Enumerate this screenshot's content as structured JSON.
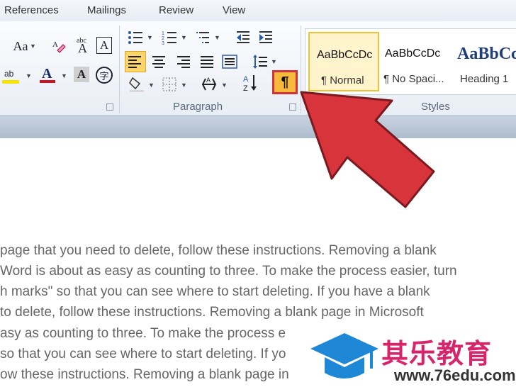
{
  "tabs": [
    "References",
    "Mailings",
    "Review",
    "View"
  ],
  "font_group": {
    "change_case_label": "Aa",
    "phonetic_label": "abc",
    "char_border_label": "A",
    "font_color_label": "A",
    "char_shading_label": "A",
    "enclose_char_label": "字",
    "font_color_hex": "#cc1122",
    "highlight_hex": "#f5e400"
  },
  "paragraph": {
    "group_label": "Paragraph",
    "show_hide_label": "¶",
    "sort_label": "A Z"
  },
  "styles": {
    "group_label": "Styles",
    "items": [
      {
        "preview": "AaBbCcDc",
        "name": "¶ Normal"
      },
      {
        "preview": "AaBbCcDc",
        "name": "¶ No Spaci..."
      },
      {
        "preview": "AaBbCc",
        "name": "Heading 1"
      }
    ]
  },
  "document": {
    "lines": [
      "page that you need to delete, follow these instructions. Removing a blank",
      "Word is about as easy as counting to three. To make the process easier, turn",
      "h marks\" so that you can see where to start deleting. If you have a blank",
      "to delete, follow these instructions. Removing a blank page in Microsoft",
      "asy as counting to three. To make the process e",
      "so that you can see where to start deleting. If yo",
      "ow these instructions. Removing a blank page in"
    ]
  },
  "watermark": {
    "title": "其乐教育",
    "url": "www.76edu.com",
    "brand_color": "#d6256a",
    "cap_color": "#1e88d6"
  },
  "annotation": {
    "arrow_color": "#d8343c"
  }
}
